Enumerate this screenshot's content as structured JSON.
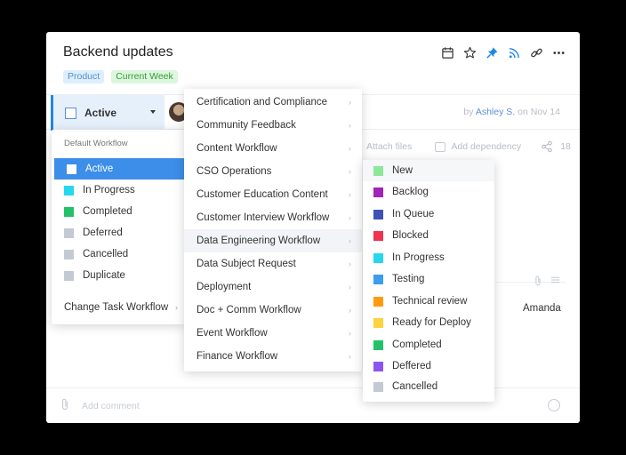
{
  "task": {
    "title": "Backend updates",
    "tags": [
      "Product",
      "Current Week"
    ],
    "status": "Active",
    "byline_prefix": "by",
    "author": "Ashley S.",
    "byline_suffix": "on Nov 14",
    "attach_files": "Attach files",
    "add_dependency": "Add dependency",
    "share_count": "18",
    "assignee": "Amanda",
    "comment_placeholder": "Add comment"
  },
  "status_menu": {
    "header": "Default Workflow",
    "items": [
      {
        "label": "Active",
        "color": "#ffffff",
        "selected": true
      },
      {
        "label": "In Progress",
        "color": "#26d7f0"
      },
      {
        "label": "Completed",
        "color": "#21c26a"
      },
      {
        "label": "Deferred",
        "color": "#c3cad4"
      },
      {
        "label": "Cancelled",
        "color": "#c3cad4"
      },
      {
        "label": "Duplicate",
        "color": "#c3cad4"
      }
    ],
    "change_label": "Change Task Workflow",
    "chevron_glyph": "›"
  },
  "workflow_menu": {
    "items": [
      "Certification and Compliance",
      "Community Feedback",
      "Content Workflow",
      "CSO Operations",
      "Customer Education Content",
      "Customer Interview Workflow",
      "Data Engineering Workflow",
      "Data Subject Request",
      "Deployment",
      "Doc + Comm Workflow",
      "Event Workflow",
      "Finance Workflow"
    ],
    "highlighted": "Data Engineering Workflow"
  },
  "data_eng_menu": {
    "items": [
      {
        "label": "New",
        "color": "#8ee89a"
      },
      {
        "label": "Backlog",
        "color": "#a323b8"
      },
      {
        "label": "In Queue",
        "color": "#3f51b5"
      },
      {
        "label": "Blocked",
        "color": "#f0334f"
      },
      {
        "label": "In Progress",
        "color": "#26d7f0"
      },
      {
        "label": "Testing",
        "color": "#3c9df0"
      },
      {
        "label": "Technical review",
        "color": "#ff9a0f"
      },
      {
        "label": "Ready for Deploy",
        "color": "#fdd23e"
      },
      {
        "label": "Completed",
        "color": "#21c26a"
      },
      {
        "label": "Deffered",
        "color": "#8c55f0"
      },
      {
        "label": "Cancelled",
        "color": "#c3cad4"
      }
    ]
  },
  "icons": [
    "calendar-icon",
    "star-icon",
    "pin-icon",
    "rss-icon",
    "link-icon",
    "more-icon",
    "paperclip-icon",
    "share-icon",
    "smile-icon",
    "list-icon"
  ]
}
